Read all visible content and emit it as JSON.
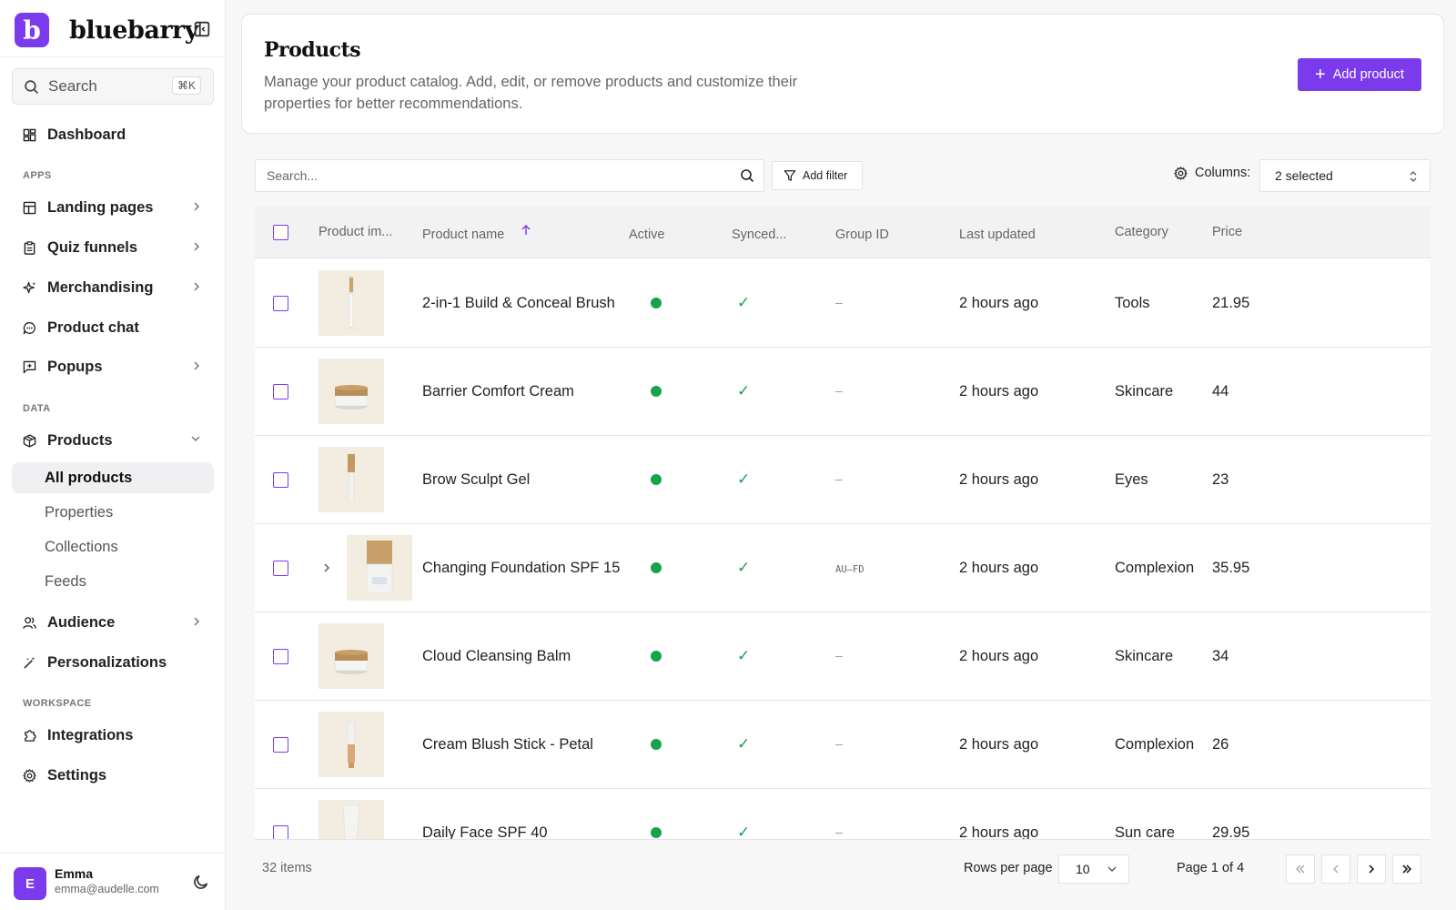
{
  "brand": {
    "logo_letter": "b",
    "name": "bluebarry",
    "accent": "#7c3aed"
  },
  "sidebar": {
    "search_label": "Search",
    "search_shortcut": "⌘K",
    "dashboard": "Dashboard",
    "section_apps": "APPS",
    "apps": [
      "Landing pages",
      "Quiz funnels",
      "Merchandising",
      "Product chat",
      "Popups"
    ],
    "section_data": "DATA",
    "products": "Products",
    "product_sub": [
      "All products",
      "Properties",
      "Collections",
      "Feeds"
    ],
    "audience": "Audience",
    "personalizations": "Personalizations",
    "section_workspace": "WORKSPACE",
    "integrations": "Integrations",
    "settings": "Settings"
  },
  "user": {
    "initial": "E",
    "name": "Emma",
    "email": "emma@audelle.com"
  },
  "header": {
    "title": "Products",
    "description": "Manage your product catalog. Add, edit, or remove products and customize their properties for better recommendations.",
    "add_button": "Add product"
  },
  "toolbar": {
    "search_placeholder": "Search...",
    "filter_label": "Add filter",
    "columns_label": "Columns:",
    "columns_value": "2 selected"
  },
  "table": {
    "columns": [
      "Product im...",
      "Product name",
      "Active",
      "Synced...",
      "Group ID",
      "Last updated",
      "Category",
      "Price"
    ],
    "rows": [
      {
        "name": "2-in-1 Build & Conceal Brush",
        "group_id": "–",
        "updated": "2 hours ago",
        "category": "Tools",
        "price": "21.95",
        "thumb": "brush"
      },
      {
        "name": "Barrier Comfort Cream",
        "group_id": "–",
        "updated": "2 hours ago",
        "category": "Skincare",
        "price": "44",
        "thumb": "jar"
      },
      {
        "name": "Brow Sculpt Gel",
        "group_id": "–",
        "updated": "2 hours ago",
        "category": "Eyes",
        "price": "23",
        "thumb": "wand"
      },
      {
        "name": "Changing Foundation SPF 15",
        "group_id": "AU–FD",
        "updated": "2 hours ago",
        "category": "Complexion",
        "price": "35.95",
        "thumb": "bottle",
        "expandable": true
      },
      {
        "name": "Cloud Cleansing Balm",
        "group_id": "–",
        "updated": "2 hours ago",
        "category": "Skincare",
        "price": "34",
        "thumb": "jar"
      },
      {
        "name": "Cream Blush Stick - Petal",
        "group_id": "–",
        "updated": "2 hours ago",
        "category": "Complexion",
        "price": "26",
        "thumb": "stick"
      },
      {
        "name": "Daily Face SPF 40",
        "group_id": "–",
        "updated": "2 hours ago",
        "category": "Sun care",
        "price": "29.95",
        "thumb": "tube"
      }
    ]
  },
  "footer": {
    "item_count": "32 items",
    "rows_per_page_label": "Rows per page",
    "rows_per_page_value": "10",
    "page_info": "Page 1 of 4"
  }
}
